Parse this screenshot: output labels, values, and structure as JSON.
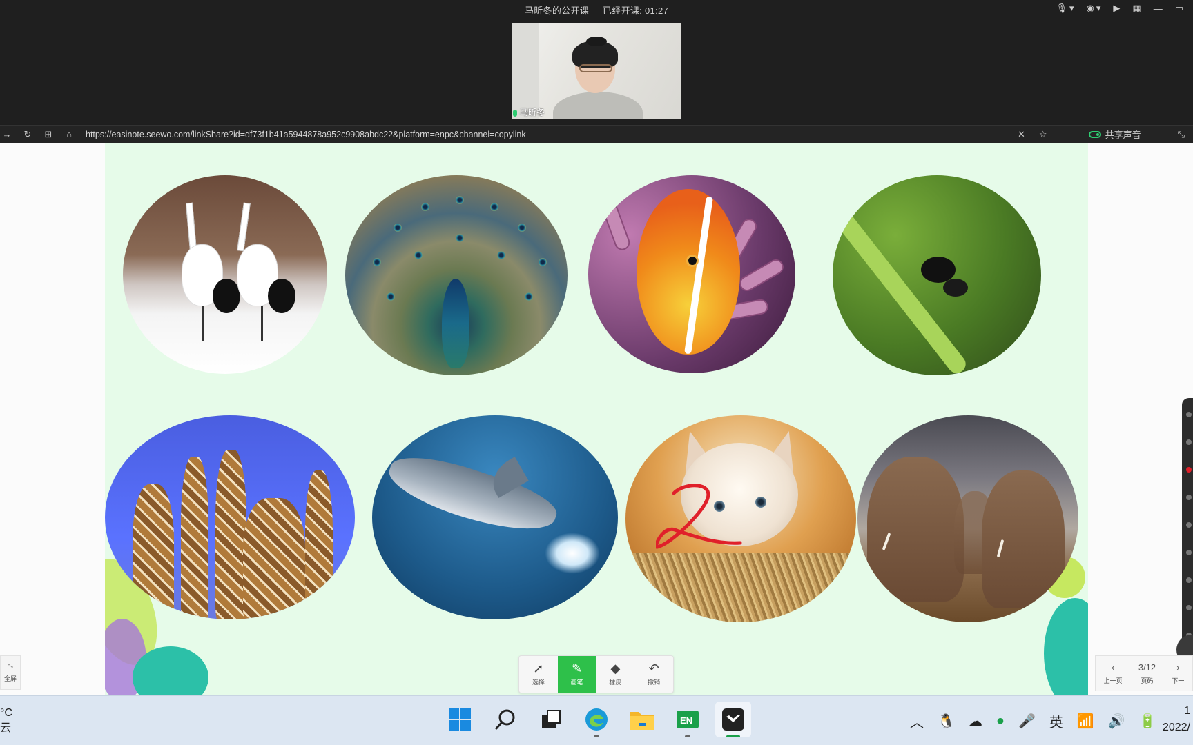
{
  "meeting": {
    "title": "马昕冬的公开课",
    "elapsed": "已经开课: 01:27"
  },
  "video": {
    "name": "马昕冬"
  },
  "browser": {
    "url": "https://easinote.seewo.com/linkShare?id=df73f1b41a5944878a952c9908abdc22&platform=enpc&channel=copylink",
    "share_audio_label": "共享声音"
  },
  "slide": {
    "ink_text": "2",
    "images": [
      "red-crowned cranes",
      "peacock",
      "clownfish",
      "ant on stem",
      "giraffes",
      "dolphin",
      "kitten",
      "elephants"
    ]
  },
  "toolbar": {
    "tools": [
      {
        "label": "选择",
        "icon": "cursor-icon"
      },
      {
        "label": "画笔",
        "icon": "pen-icon",
        "active": true
      },
      {
        "label": "橡皮",
        "icon": "eraser-icon"
      },
      {
        "label": "撤销",
        "icon": "undo-icon"
      }
    ]
  },
  "fullscreen": {
    "label": "全屏"
  },
  "pager": {
    "prev_label": "上一页",
    "page": "3/12",
    "page_label": "页码",
    "next_label": "下一"
  },
  "taskbar": {
    "weather_temp": "°C",
    "weather_desc": "云",
    "ime": "英",
    "clock_time": "1",
    "clock_date": "2022/"
  },
  "colors": {
    "accent_green": "#2ec04a",
    "slide_bg": "#e6fbe9",
    "ink_red": "#e0202a"
  }
}
